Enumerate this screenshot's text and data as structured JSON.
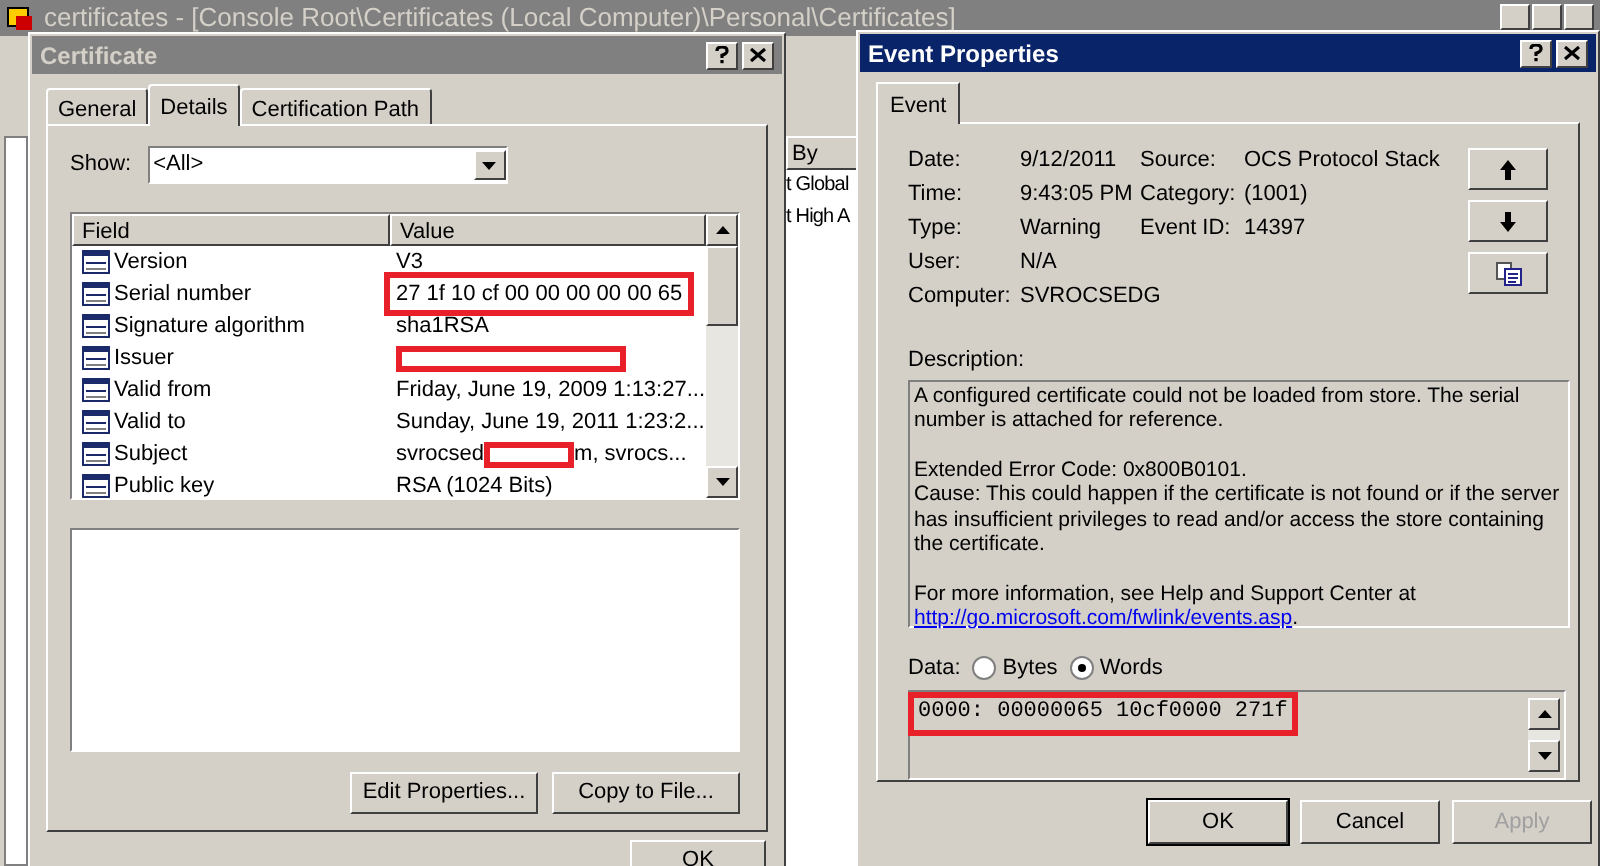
{
  "background_window": {
    "title": "certificates - [Console Root\\Certificates (Local Computer)\\Personal\\Certificates]",
    "column_header": "By",
    "rows": [
      "t Global",
      "t High A"
    ]
  },
  "certificate_dialog": {
    "title": "Certificate",
    "active": false,
    "tabs": [
      {
        "label": "General",
        "selected": false
      },
      {
        "label": "Details",
        "selected": true
      },
      {
        "label": "Certification Path",
        "selected": false
      }
    ],
    "show_label": "Show:",
    "show_value": "<All>",
    "columns": [
      "Field",
      "Value"
    ],
    "rows": [
      {
        "field": "Version",
        "value": "V3",
        "highlighted": false,
        "redacted": false
      },
      {
        "field": "Serial number",
        "value": "27 1f 10 cf 00 00 00 00 00 65",
        "highlighted": true,
        "redacted": false
      },
      {
        "field": "Signature algorithm",
        "value": "sha1RSA",
        "highlighted": false,
        "redacted": false
      },
      {
        "field": "Issuer",
        "highlighted": false,
        "redacted": true
      },
      {
        "field": "Valid from",
        "value": "Friday, June 19, 2009 1:13:27...",
        "highlighted": false,
        "redacted": false
      },
      {
        "field": "Valid to",
        "value": "Sunday, June 19, 2011 1:23:2...",
        "highlighted": false,
        "redacted": false
      },
      {
        "field": "Subject",
        "value": "svrocsed",
        "value_after": "m, svrocs...",
        "highlighted": false,
        "redacted": true
      },
      {
        "field": "Public key",
        "value": "RSA (1024 Bits)",
        "highlighted": false,
        "redacted": false
      }
    ],
    "buttons": [
      "Edit Properties...",
      "Copy to File..."
    ],
    "ok_button": "OK"
  },
  "event_dialog": {
    "title": "Event Properties",
    "active": true,
    "tabs": [
      {
        "label": "Event",
        "selected": true
      }
    ],
    "fields": [
      {
        "label": "Date:",
        "value": "9/12/2011",
        "label2": "Source:",
        "value2": "OCS Protocol Stack"
      },
      {
        "label": "Time:",
        "value": "9:43:05 PM",
        "label2": "Category:",
        "value2": "(1001)"
      },
      {
        "label": "Type:",
        "value": "Warning",
        "label2": "Event ID:",
        "value2": "14397"
      },
      {
        "label": "User:",
        "value": "N/A"
      },
      {
        "label": "Computer:",
        "value": "SVROCSEDG"
      }
    ],
    "description_label": "Description:",
    "description": [
      "A configured certificate could not be loaded from store. The serial number is attached for reference.",
      "Extended Error Code: 0x800B0101.\nCause: This could happen if the certificate is not found or if the server has insufficient privileges to read and/or access the store containing the certificate.",
      "For more information, see Help and Support Center at"
    ],
    "link": "http://go.microsoft.com/fwlink/events.asp",
    "link_end": ".",
    "data_label": "Data:",
    "radios": [
      {
        "label": "Bytes",
        "selected": false
      },
      {
        "label": "Words",
        "selected": true
      }
    ],
    "data": "0000: 00000065 10cf0000 271f",
    "buttons": [
      {
        "label": "OK",
        "disabled": false
      },
      {
        "label": "Cancel",
        "disabled": false
      },
      {
        "label": "Apply",
        "disabled": true
      }
    ]
  }
}
